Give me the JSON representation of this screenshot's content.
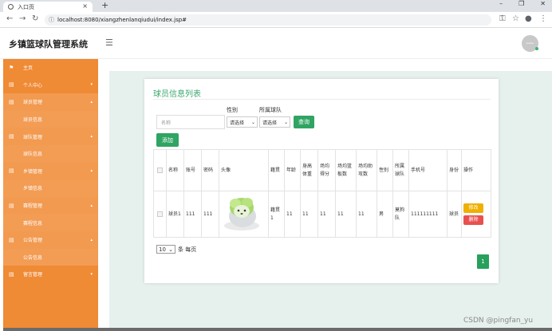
{
  "browser": {
    "tab_title": "入口页",
    "tab_close": "×",
    "new_tab": "+",
    "url": "localhost:8080/xiangzhenlanqiudui/index.jsp#",
    "win_minimize": "–",
    "win_restore": "❐",
    "win_close": "✕"
  },
  "app": {
    "title": "乡镇篮球队管理系统",
    "avatar_text": "avatar"
  },
  "sidebar": {
    "items": [
      {
        "label": "主页",
        "icon": "flag-icon"
      },
      {
        "label": "个人中心",
        "icon": "list-icon"
      },
      {
        "label": "球员管理",
        "icon": "list-icon",
        "sub": "球员信息"
      },
      {
        "label": "球队管理",
        "icon": "list-icon",
        "sub": "球队信息"
      },
      {
        "label": "乡镇管理",
        "icon": "list-icon",
        "sub": "乡镇信息"
      },
      {
        "label": "赛程管理",
        "icon": "list-icon",
        "sub": "赛程信息"
      },
      {
        "label": "公告管理",
        "icon": "list-icon",
        "sub": "公告信息"
      },
      {
        "label": "留言管理",
        "icon": "list-icon"
      }
    ]
  },
  "page": {
    "title": "球员信息列表",
    "filters": {
      "name_placeholder": "名称",
      "gender_label": "性别",
      "gender_value": "请选择",
      "team_label": "所属球队",
      "team_value": "请选择",
      "query_button": "查询",
      "add_button": "添加"
    },
    "table": {
      "headers": [
        "名称",
        "账号",
        "密码",
        "头像",
        "籍贯",
        "年龄",
        "身高体重",
        "场均得分",
        "场均篮板数",
        "场均助攻数",
        "性别",
        "所属球队",
        "手机号",
        "身份",
        "操作"
      ],
      "rows": [
        {
          "name": "球员1",
          "account": "111",
          "password": "111",
          "hometown": "籍贯1",
          "age": "11",
          "height_weight": "11",
          "avg_points": "11",
          "avg_rebounds": "11",
          "avg_assists": "11",
          "gender": "男",
          "team": "莫狗队",
          "phone": "111111111",
          "role": "球员",
          "edit": "修改",
          "delete": "删除"
        }
      ]
    },
    "pagination": {
      "per_page_value": "10",
      "per_page_suffix": "条 每页",
      "current_page": "1"
    }
  },
  "watermark": "CSDN @pingfan_yu"
}
